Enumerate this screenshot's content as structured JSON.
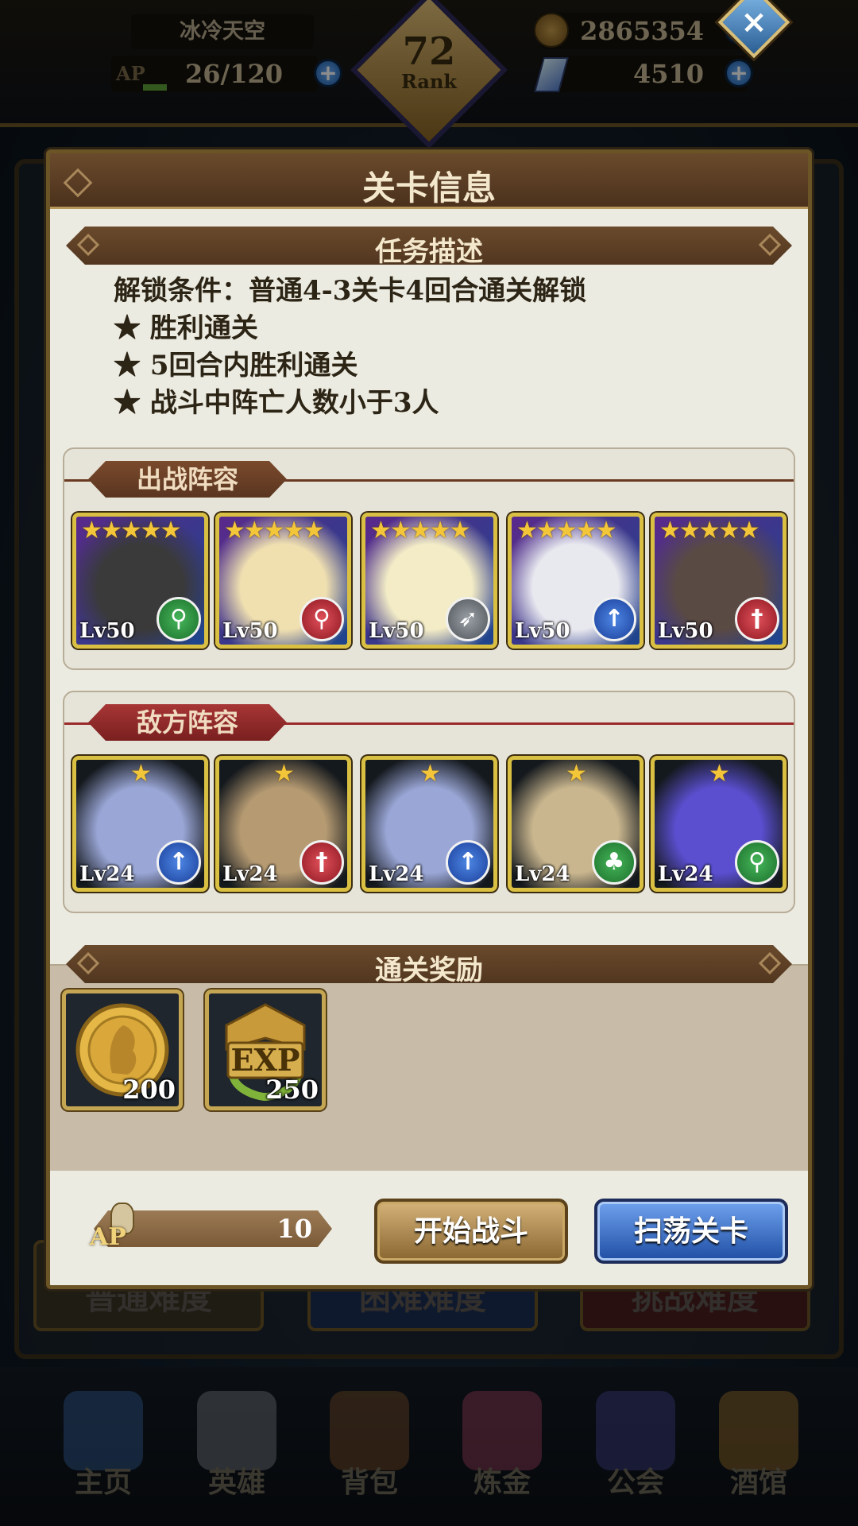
{
  "player": {
    "name": "冰冷天空",
    "ap_label": "AP",
    "ap": "26/120",
    "rank": "72",
    "rank_label": "Rank",
    "gold": "2865354",
    "gems": "4510"
  },
  "background": {
    "difficulty_tabs": [
      "普通难度",
      "困难难度",
      "挑战难度"
    ]
  },
  "nav": {
    "items": [
      {
        "label": "主页",
        "icon": "castle-icon",
        "color": "#3c6fb0"
      },
      {
        "label": "英雄",
        "icon": "helmet-icon",
        "color": "#8a8f99"
      },
      {
        "label": "背包",
        "icon": "backpack-icon",
        "color": "#8a5a30"
      },
      {
        "label": "炼金",
        "icon": "potion-icon",
        "color": "#b04a6a"
      },
      {
        "label": "公会",
        "icon": "shield-icon",
        "color": "#4a4aa0"
      },
      {
        "label": "酒馆",
        "icon": "beer-mug-icon",
        "color": "#b08030"
      }
    ]
  },
  "modal": {
    "title": "关卡信息",
    "task": {
      "heading": "任务描述",
      "unlock": "解锁条件：普通4-3关卡4回合通关解锁",
      "objectives": [
        "★ 胜利通关",
        "★ 5回合内胜利通关",
        "★ 战斗中阵亡人数小于3人"
      ]
    },
    "ally": {
      "heading": "出战阵容",
      "units": [
        {
          "level": "Lv50",
          "stars": 5,
          "class_icon": "staff-icon",
          "class_glyph": "⚲",
          "class_color": "green",
          "portrait_color": "#3a3a3a"
        },
        {
          "level": "Lv50",
          "stars": 5,
          "class_icon": "staff-icon",
          "class_glyph": "⚲",
          "class_color": "red",
          "portrait_color": "#f0e0b0"
        },
        {
          "level": "Lv50",
          "stars": 5,
          "class_icon": "bow-icon",
          "class_glyph": "➶",
          "class_color": "gray",
          "portrait_color": "#f3ecc6"
        },
        {
          "level": "Lv50",
          "stars": 5,
          "class_icon": "spear-icon",
          "class_glyph": "↑",
          "class_color": "blue",
          "portrait_color": "#e8e8ef"
        },
        {
          "level": "Lv50",
          "stars": 5,
          "class_icon": "sword-icon",
          "class_glyph": "†",
          "class_color": "red",
          "portrait_color": "#5a4a44"
        }
      ]
    },
    "enemy": {
      "heading": "敌方阵容",
      "units": [
        {
          "level": "Lv24",
          "stars": 1,
          "class_icon": "spear-icon",
          "class_glyph": "↑",
          "class_color": "blue",
          "portrait_color": "#9aa6d6"
        },
        {
          "level": "Lv24",
          "stars": 1,
          "class_icon": "sword-icon",
          "class_glyph": "†",
          "class_color": "red",
          "portrait_color": "#b59a72"
        },
        {
          "level": "Lv24",
          "stars": 1,
          "class_icon": "spear-icon",
          "class_glyph": "↑",
          "class_color": "blue",
          "portrait_color": "#9aa6d6"
        },
        {
          "level": "Lv24",
          "stars": 1,
          "class_icon": "axe-icon",
          "class_glyph": "♣",
          "class_color": "green",
          "portrait_color": "#c9b68e"
        },
        {
          "level": "Lv24",
          "stars": 1,
          "class_icon": "staff-icon",
          "class_glyph": "⚲",
          "class_color": "green",
          "portrait_color": "#5b4fd0"
        }
      ]
    },
    "rewards": {
      "heading": "通关奖励",
      "items": [
        {
          "icon": "gold-coin-icon",
          "count": "200"
        },
        {
          "icon": "exp-badge-icon",
          "label": "EXP",
          "count": "250"
        }
      ]
    },
    "cost": {
      "label": "AP",
      "value": "10"
    },
    "buttons": {
      "start": "开始战斗",
      "sweep": "扫荡关卡"
    }
  },
  "colors": {
    "ally_accent": "#6a3a22",
    "enemy_accent": "#9b2b2b",
    "star": "#f3c63a"
  }
}
